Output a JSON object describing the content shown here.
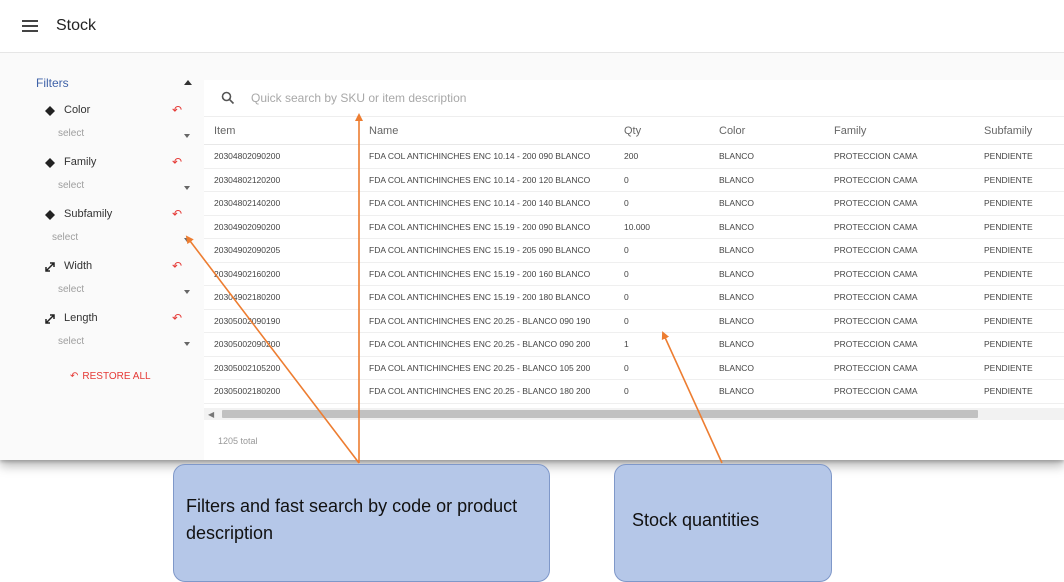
{
  "header": {
    "title": "Stock"
  },
  "sidebar": {
    "filters_label": "Filters",
    "filters": [
      {
        "label": "Color",
        "placeholder": "select",
        "icon": "paint-icon"
      },
      {
        "label": "Family",
        "placeholder": "select",
        "icon": "paint-icon"
      },
      {
        "label": "Subfamily",
        "placeholder": "select",
        "icon": "paint-icon"
      },
      {
        "label": "Width",
        "placeholder": "select",
        "icon": "diagonal-resize-icon"
      },
      {
        "label": "Length",
        "placeholder": "select",
        "icon": "diagonal-resize-icon"
      }
    ],
    "restore_all": "RESTORE ALL"
  },
  "search": {
    "placeholder": "Quick search by SKU or item description"
  },
  "table": {
    "columns": [
      "Item",
      "Name",
      "Qty",
      "Color",
      "Family",
      "Subfamily"
    ],
    "rows": [
      [
        "20304802090200",
        "FDA COL ANTICHINCHES ENC 10.14 - 200 090 BLANCO",
        "200",
        "BLANCO",
        "PROTECCION CAMA",
        "PENDIENTE"
      ],
      [
        "20304802120200",
        "FDA COL ANTICHINCHES ENC 10.14 - 200 120 BLANCO",
        "0",
        "BLANCO",
        "PROTECCION CAMA",
        "PENDIENTE"
      ],
      [
        "20304802140200",
        "FDA COL ANTICHINCHES ENC 10.14 - 200 140 BLANCO",
        "0",
        "BLANCO",
        "PROTECCION CAMA",
        "PENDIENTE"
      ],
      [
        "20304902090200",
        "FDA COL ANTICHINCHES ENC 15.19 - 200 090 BLANCO",
        "10.000",
        "BLANCO",
        "PROTECCION CAMA",
        "PENDIENTE"
      ],
      [
        "20304902090205",
        "FDA COL ANTICHINCHES ENC 15.19 - 205 090 BLANCO",
        "0",
        "BLANCO",
        "PROTECCION CAMA",
        "PENDIENTE"
      ],
      [
        "20304902160200",
        "FDA COL ANTICHINCHES ENC 15.19 - 200 160 BLANCO",
        "0",
        "BLANCO",
        "PROTECCION CAMA",
        "PENDIENTE"
      ],
      [
        "20304902180200",
        "FDA COL ANTICHINCHES ENC 15.19 - 200 180 BLANCO",
        "0",
        "BLANCO",
        "PROTECCION CAMA",
        "PENDIENTE"
      ],
      [
        "20305002090190",
        "FDA COL ANTICHINCHES ENC 20.25 - BLANCO 090 190",
        "0",
        "BLANCO",
        "PROTECCION CAMA",
        "PENDIENTE"
      ],
      [
        "20305002090200",
        "FDA COL ANTICHINCHES ENC 20.25 - BLANCO 090 200",
        "1",
        "BLANCO",
        "PROTECCION CAMA",
        "PENDIENTE"
      ],
      [
        "20305002105200",
        "FDA COL ANTICHINCHES ENC 20.25 - BLANCO 105 200",
        "0",
        "BLANCO",
        "PROTECCION CAMA",
        "PENDIENTE"
      ],
      [
        "20305002180200",
        "FDA COL ANTICHINCHES ENC 20.25 - BLANCO 180 200",
        "0",
        "BLANCO",
        "PROTECCION CAMA",
        "PENDIENTE"
      ]
    ],
    "total": "1205 total"
  },
  "annotations": {
    "filters_callout": "Filters and fast search by code or product description",
    "stock_callout": "Stock quantities",
    "arrow_color": "#ed7d31"
  },
  "colors": {
    "accent": "#3f62a8",
    "restore": "#e53935",
    "callout_fill": "#b5c7e8"
  }
}
